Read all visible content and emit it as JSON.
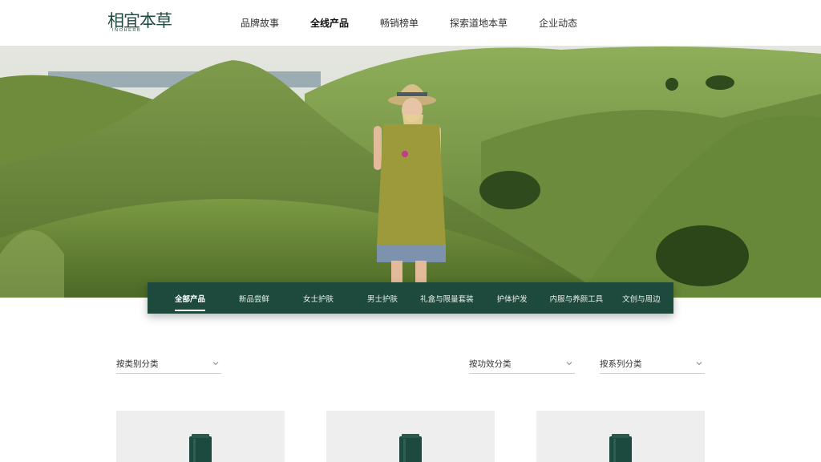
{
  "brand": {
    "name_cn": "相宜本草",
    "name_en": "INOHERB",
    "color": "#1f4a3f"
  },
  "nav": {
    "items": [
      {
        "label": "品牌故事",
        "active": false
      },
      {
        "label": "全线产品",
        "active": true
      },
      {
        "label": "畅销榜单",
        "active": false
      },
      {
        "label": "探索道地本草",
        "active": false
      },
      {
        "label": "企业动态",
        "active": false
      }
    ]
  },
  "category_tabs": {
    "background": "#1e4a3d",
    "items": [
      {
        "label": "全部产品",
        "active": true
      },
      {
        "label": "新品尝鲜",
        "active": false
      },
      {
        "label": "女士护肤",
        "active": false
      },
      {
        "label": "男士护肤",
        "active": false
      },
      {
        "label": "礼盒与限量套装",
        "active": false
      },
      {
        "label": "护体护发",
        "active": false
      },
      {
        "label": "内服与养颜工具",
        "active": false
      },
      {
        "label": "文创与周边",
        "active": false
      }
    ]
  },
  "filters": {
    "by_type": {
      "label": "按类别分类",
      "icon": "chevron-down-icon"
    },
    "by_effect": {
      "label": "按功效分类",
      "icon": "chevron-down-icon"
    },
    "by_series": {
      "label": "按系列分类",
      "icon": "chevron-down-icon"
    }
  },
  "products": [
    {
      "icon": "product-bottle-icon",
      "color": "#1d4a3f"
    },
    {
      "icon": "product-bottle-icon",
      "color": "#1d4a3f"
    },
    {
      "icon": "product-bottle-icon",
      "color": "#1d4a3f"
    }
  ]
}
